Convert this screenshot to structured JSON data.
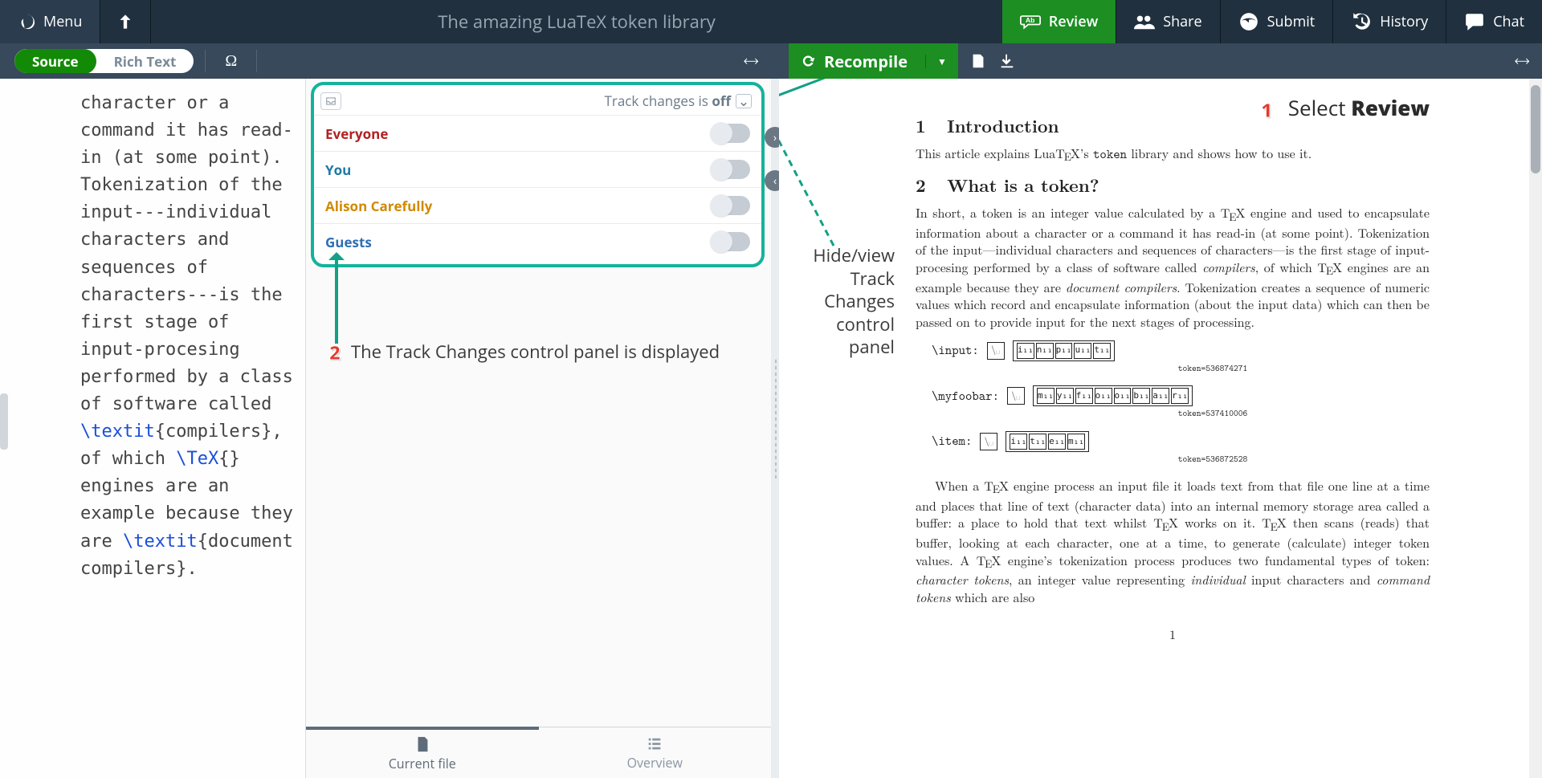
{
  "topbar": {
    "menu": "Menu",
    "project_name": "The amazing LuaTeX token library",
    "review": "Review",
    "share": "Share",
    "submit": "Submit",
    "history": "History",
    "chat": "Chat"
  },
  "subbar": {
    "source": "Source",
    "rich": "Rich Text",
    "omega": "Ω",
    "recompile": "Recompile"
  },
  "editor_code": "character or a command it has read-in (at some point). Tokenization of the input---individual characters and sequences of characters---is the first stage of input-procesing performed by a class of software called ",
  "editor_code_cmd1": "\\textit",
  "editor_code_mid1": "{compilers}, of which ",
  "editor_code_cmd2": "\\TeX",
  "editor_code_mid2": "{} engines are an example because they are ",
  "editor_code_cmd3": "\\textit",
  "editor_code_tail": "{document compilers}. ",
  "track": {
    "status_prefix": "Track changes is ",
    "status_value": "off",
    "rows": {
      "everyone": "Everyone",
      "you": "You",
      "alison": "Alison Carefully",
      "guests": "Guests"
    }
  },
  "review_tabs": {
    "current": "Current file",
    "overview": "Overview"
  },
  "callouts": {
    "num1": "1",
    "text1_a": "Select ",
    "text1_b": "Review",
    "num2": "2",
    "text2": "The Track Changes control panel is displayed",
    "hide": "Hide/view Track Changes control panel"
  },
  "pdf": {
    "h1num": "1",
    "h1": "Introduction",
    "p1": "This article explains LuaTEX’s token library and shows how to use it.",
    "h2num": "2",
    "h2": "What is a token?",
    "p2": "In short, a token is an integer value calculated by a TEX engine and used to encapsulate information about a character or a command it has read-in (at some point). Tokenization of the input—individual characters and sequences of characters—is the first stage of input-procesing performed by a class of software called compilers, of which TEX engines are an example because they are document compilers. Tokenization creates a sequence of numeric values which record and encapsulate information (about the input data) which can then be passed on to provide input for the next stages of processing.",
    "tok1_lbl": "\\input:",
    "tok1_chars": [
      "i",
      "n",
      "p",
      "u",
      "t"
    ],
    "tok1_cap": "token=536874271",
    "tok2_lbl": "\\myfoobar:",
    "tok2_chars": [
      "m",
      "y",
      "f",
      "o",
      "o",
      "b",
      "a",
      "r"
    ],
    "tok2_cap": "token=537410006",
    "tok3_lbl": "\\item:",
    "tok3_chars": [
      "i",
      "t",
      "e",
      "m"
    ],
    "tok3_cap": "token=536872528",
    "p3": "When a TEX engine process an input file it loads text from that file one line at a time and places that line of text (character data) into an internal memory storage area called a buffer: a place to hold that text whilst TEX works on it. TEX then scans (reads) that buffer, looking at each character, one at a time, to generate (calculate) integer token values. A TEX engine’s tokenization process produces two fundamental types of token: character tokens, an integer value representing individual input characters and command tokens which are also",
    "page": "1"
  }
}
